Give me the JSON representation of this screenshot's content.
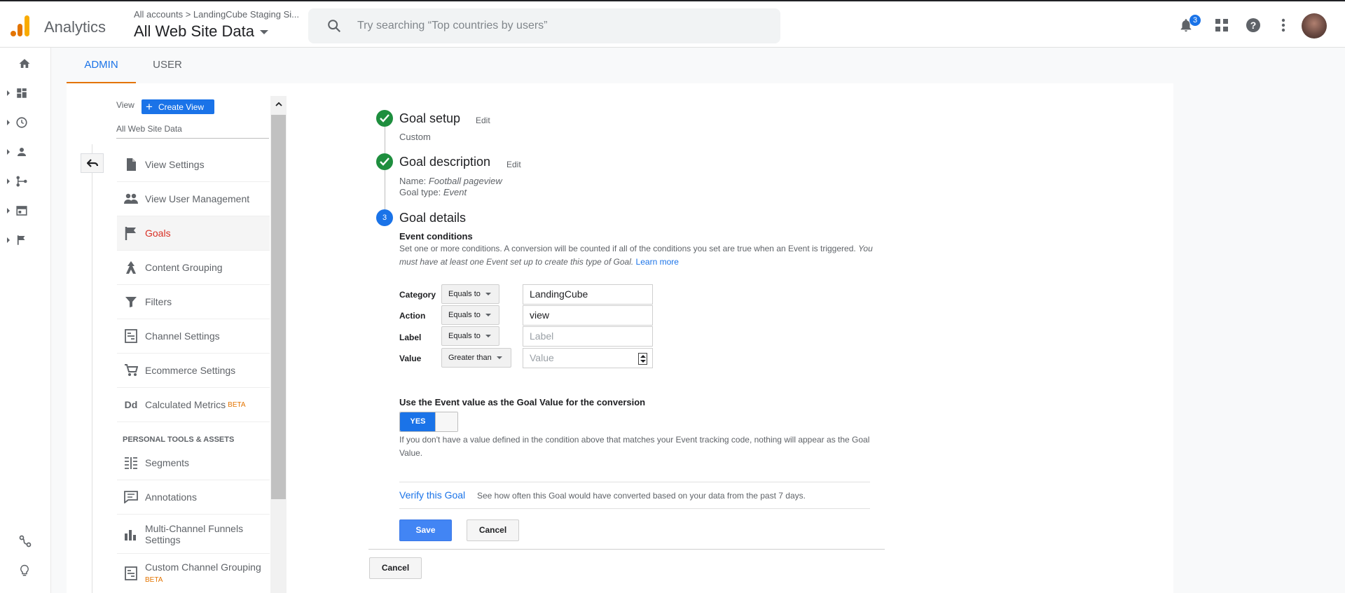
{
  "app": {
    "title": "Analytics",
    "breadcrumb": "All accounts > LandingCube Staging Si...",
    "view_name": "All Web Site Data",
    "search_placeholder": "Try searching “Top countries by users”",
    "notification_count": "3",
    "colors": {
      "brand_orange": "#f9ab00",
      "brand_dark": "#e37400",
      "accent_blue": "#1a73e8",
      "success_green": "#1e8e3e",
      "active_red": "#d93025"
    }
  },
  "left_rail": {
    "items": [
      "home-icon",
      "customization-icon",
      "realtime-icon",
      "audience-icon",
      "acquisition-icon",
      "behavior-icon",
      "conversions-icon"
    ],
    "bottom": [
      "attribution-icon",
      "discover-icon"
    ]
  },
  "tabs": [
    {
      "label": "ADMIN",
      "active": true
    },
    {
      "label": "USER",
      "active": false
    }
  ],
  "nav": {
    "view_label": "View",
    "create_view_label": "Create View",
    "selected_view": "All Web Site Data",
    "items": [
      {
        "label": "View Settings",
        "icon": "document-icon"
      },
      {
        "label": "View User Management",
        "icon": "people-icon"
      },
      {
        "label": "Goals",
        "icon": "flag-icon",
        "active": true
      },
      {
        "label": "Content Grouping",
        "icon": "grouping-icon"
      },
      {
        "label": "Filters",
        "icon": "filter-icon"
      },
      {
        "label": "Channel Settings",
        "icon": "channel-icon"
      },
      {
        "label": "Ecommerce Settings",
        "icon": "cart-icon"
      },
      {
        "label": "Calculated Metrics",
        "icon": "dd-icon",
        "badge": "BETA"
      }
    ],
    "section_personal": "PERSONAL TOOLS & ASSETS",
    "personal_items": [
      {
        "label": "Segments",
        "icon": "segments-icon"
      },
      {
        "label": "Annotations",
        "icon": "annotation-icon"
      },
      {
        "label": "Multi-Channel Funnels",
        "label2": "Settings",
        "icon": "bar-chart-icon"
      },
      {
        "label": "Custom Channel Grouping",
        "badge": "BETA",
        "icon": "channel-icon"
      }
    ]
  },
  "goal": {
    "setup": {
      "title": "Goal setup",
      "edit": "Edit",
      "value": "Custom"
    },
    "description": {
      "title": "Goal description",
      "edit": "Edit",
      "name_label": "Name:",
      "name_value": "Football pageview",
      "type_label": "Goal type:",
      "type_value": "Event"
    },
    "details": {
      "step": "3",
      "title": "Goal details",
      "event_conditions_title": "Event conditions",
      "help_text": "Set one or more conditions. A conversion will be counted if all of the conditions you set are true when an Event is triggered.",
      "help_italic_1": "You",
      "help_italic_2": "must have at least one Event set up to create this type of Goal.",
      "learn_more": "Learn more",
      "conditions": [
        {
          "label": "Category",
          "operator": "Equals to",
          "value": "LandingCube",
          "placeholder": ""
        },
        {
          "label": "Action",
          "operator": "Equals to",
          "value": "view",
          "placeholder": ""
        },
        {
          "label": "Label",
          "operator": "Equals to",
          "value": "",
          "placeholder": "Label"
        },
        {
          "label": "Value",
          "operator": "Greater than",
          "value": "",
          "placeholder": "Value"
        }
      ],
      "event_value_title": "Use the Event value as the Goal Value for the conversion",
      "toggle_label": "YES",
      "toggle_note": "If you don't have a value defined in the condition above that matches your Event tracking code, nothing will appear as the Goal",
      "toggle_note_end": "Value.",
      "verify_link": "Verify this Goal",
      "verify_desc": "See how often this Goal would have converted based on your data from the past 7 days.",
      "save_label": "Save",
      "cancel_label": "Cancel"
    },
    "outer_cancel_label": "Cancel"
  }
}
